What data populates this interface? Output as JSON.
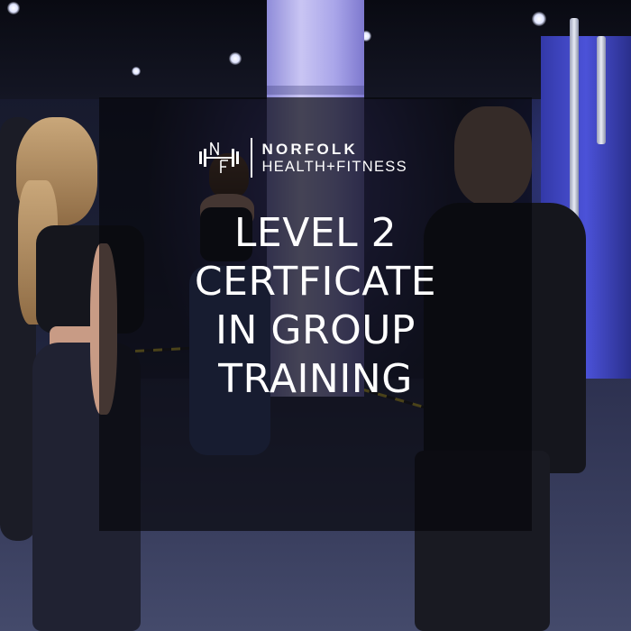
{
  "brand": {
    "monogram": "NF",
    "name_line1": "NORFOLK",
    "name_line2": "HEALTH+FITNESS"
  },
  "headline": {
    "lines": [
      "LEVEL 2",
      "CERTFICATE",
      "IN GROUP",
      "TRAINING"
    ]
  },
  "colors": {
    "overlay": "#06060a",
    "text": "#ffffff",
    "accent_blue": "#4b52d8",
    "pillar": "#c9c5f3"
  },
  "icons": {
    "logo": "dumbbell-monogram-icon"
  }
}
